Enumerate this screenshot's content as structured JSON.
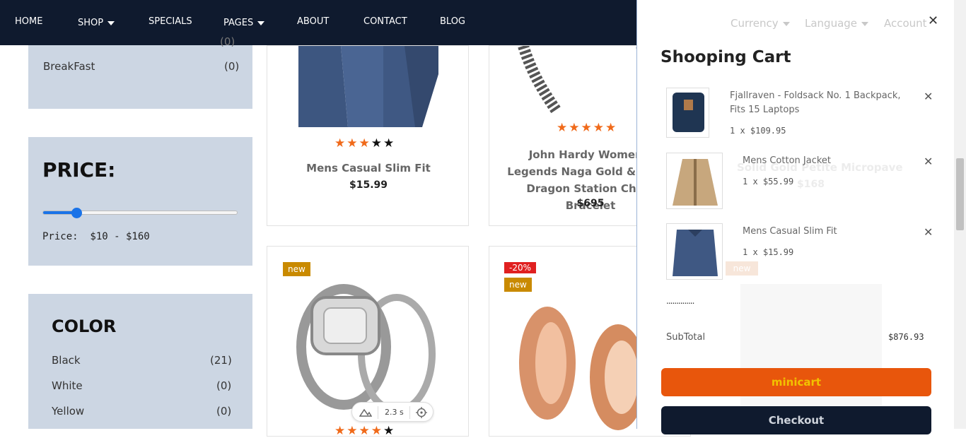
{
  "nav": {
    "items": [
      {
        "label": "HOME"
      },
      {
        "label": "SHOP"
      },
      {
        "label": "SPECIALS"
      },
      {
        "label": "PAGES"
      },
      {
        "label": "ABOUT"
      },
      {
        "label": "CONTACT"
      },
      {
        "label": "BLOG"
      }
    ],
    "right": [
      {
        "label": "Currency"
      },
      {
        "label": "Language"
      },
      {
        "label": "Account"
      }
    ]
  },
  "sidebar": {
    "category_partial_count": "(0)",
    "category": {
      "label": "BreakFast",
      "count": "(0)"
    },
    "price": {
      "title": "PRICE:",
      "label": "Price:  $10 - $160",
      "fill_fraction": 0.17
    },
    "color": {
      "title": "COLOR",
      "items": [
        {
          "label": "Black",
          "count": "(21)"
        },
        {
          "label": "White",
          "count": "(0)"
        },
        {
          "label": "Yellow",
          "count": "(0)"
        }
      ]
    }
  },
  "products": [
    {
      "name": "Mens Casual Slim Fit",
      "price": "$15.99",
      "rating": 3
    },
    {
      "name": "John Hardy Women's Legends Naga Gold & Silver Dragon Station Chain Bracelet",
      "price": "$695",
      "rating": 5
    },
    {
      "badge_new": "new"
    },
    {
      "badge_sale": "-20%",
      "badge_new": "new"
    }
  ],
  "behind": {
    "name": "Solid Gold Petite Micropave",
    "price": "$168",
    "badge": "new"
  },
  "cart": {
    "title": "Shooping Cart",
    "items": [
      {
        "name": "Fjallraven - Foldsack No. 1 Backpack, Fits 15 Laptops",
        "qty": "1 x $109.95"
      },
      {
        "name": "Mens Cotton Jacket",
        "qty": "1 x $55.99"
      },
      {
        "name": "Mens Casual Slim Fit",
        "qty": "1 x $15.99"
      }
    ],
    "dots": "..............",
    "subtotal_label": "SubTotal",
    "subtotal_value": "$876.93",
    "minicart_label": "minicart",
    "checkout_label": "Checkout"
  },
  "dev_overlay": {
    "time": "2.3 s"
  },
  "colors": {
    "nav_bg": "#0f1a2e",
    "sidebar_bg": "#ccd6e3",
    "accent": "#f06a1a",
    "minicart_btn": "#e8560c",
    "minicart_text": "#f2c200",
    "checkout_btn": "#0f1a2e",
    "badge_new": "#c98a00",
    "badge_sale": "#e02020"
  }
}
